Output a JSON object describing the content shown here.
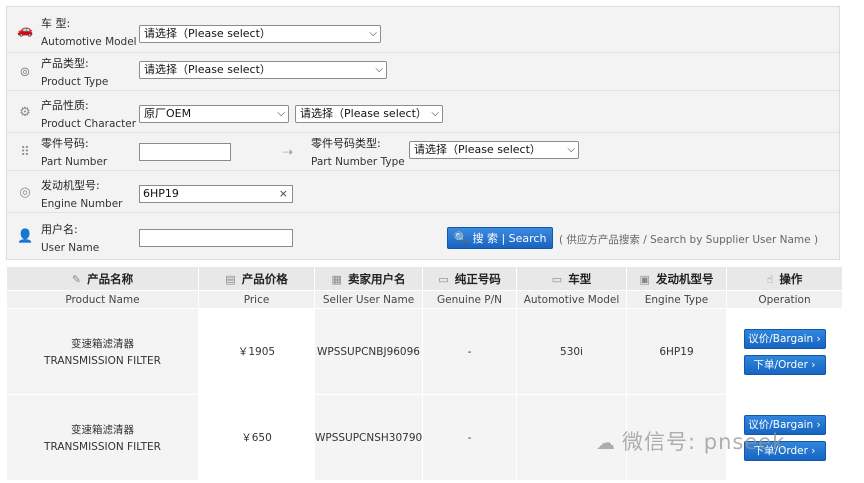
{
  "form": {
    "automotive_model": {
      "label_cn": "车  型:",
      "label_en": "Automotive Model",
      "value": "请选择（Please select）"
    },
    "product_type": {
      "label_cn": "产品类型:",
      "label_en": "Product Type",
      "value": "请选择（Please select）"
    },
    "product_character": {
      "label_cn": "产品性质:",
      "label_en": "Product Character",
      "value": "原厂OEM",
      "value2": "请选择（Please select）"
    },
    "part_number": {
      "label_cn": "零件号码:",
      "label_en": "Part Number",
      "value": "",
      "type_label_cn": "零件号码类型:",
      "type_label_en": "Part Number Type",
      "type_value": "请选择（Please select）"
    },
    "engine_number": {
      "label_cn": "发动机型号:",
      "label_en": "Engine Number",
      "value": "6HP19",
      "clear": "×"
    },
    "user_name": {
      "label_cn": "用户名:",
      "label_en": "User Name",
      "value": ""
    },
    "search_label": "搜 索 | Search",
    "search_note": "( 供应方产品搜索 / Search by Supplier User Name )"
  },
  "table": {
    "headers_cn": [
      "产品名称",
      "产品价格",
      "卖家用户名",
      "纯正号码",
      "车型",
      "发动机型号",
      "操作"
    ],
    "headers_en": [
      "Product Name",
      "Price",
      "Seller User Name",
      "Genuine P/N",
      "Automotive Model",
      "Engine Type",
      "Operation"
    ],
    "rows": [
      {
        "name_cn": "变速箱滤清器",
        "name_en": "TRANSMISSION FILTER",
        "price": "￥1905",
        "seller": "WPSSUPCNBJ96096",
        "genuine": "-",
        "model": "530i",
        "engine": "6HP19",
        "bargain": "议价/Bargain",
        "order": "下单/Order"
      },
      {
        "name_cn": "变速箱滤清器",
        "name_en": "TRANSMISSION FILTER",
        "price": "￥650",
        "seller": "WPSSUPCNSH30790",
        "genuine": "-",
        "model": "",
        "engine": "",
        "bargain": "议价/Bargain",
        "order": "下单/Order"
      }
    ]
  },
  "watermark": "微信号: pnseek"
}
